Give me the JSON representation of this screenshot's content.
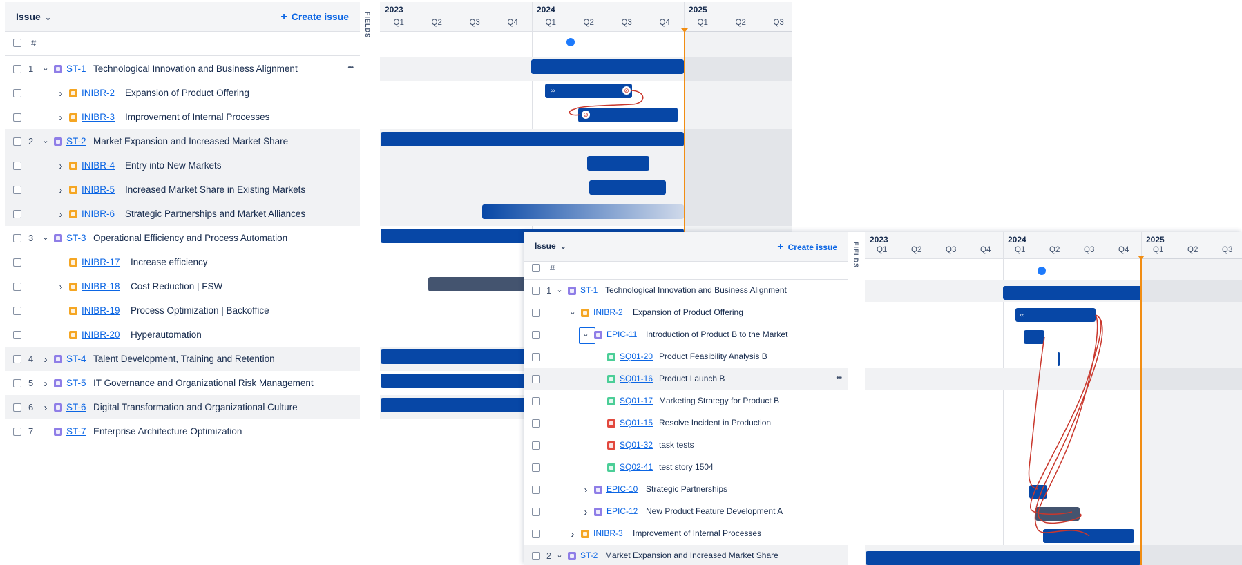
{
  "panel_a": {
    "header": {
      "issue_label": "Issue",
      "create_label": "Create issue"
    },
    "hash_label": "#",
    "fields_label": "FIELDS",
    "timeline": {
      "years": [
        "2023",
        "2024",
        "2025"
      ],
      "quarters": [
        "Q1",
        "Q2",
        "Q3",
        "Q4",
        "Q1",
        "Q2",
        "Q3",
        "Q4",
        "Q1",
        "Q2",
        "Q3"
      ]
    },
    "rows": [
      {
        "num": "1",
        "key": "ST-1",
        "title": "Technological Innovation and Business Alignment",
        "type": "story",
        "level": 0,
        "toggle": "▾"
      },
      {
        "num": "",
        "key": "INIBR-2",
        "title": "Expansion of Product Offering",
        "type": "init",
        "level": 1,
        "toggle": "›"
      },
      {
        "num": "",
        "key": "INIBR-3",
        "title": "Improvement of Internal Processes",
        "type": "init",
        "level": 1,
        "toggle": "›"
      },
      {
        "num": "2",
        "key": "ST-2",
        "title": "Market Expansion and Increased Market Share",
        "type": "story",
        "level": 0,
        "toggle": "▾"
      },
      {
        "num": "",
        "key": "INIBR-4",
        "title": "Entry into New Markets",
        "type": "init",
        "level": 1,
        "toggle": "›"
      },
      {
        "num": "",
        "key": "INIBR-5",
        "title": "Increased Market Share in Existing Markets",
        "type": "init",
        "level": 1,
        "toggle": "›"
      },
      {
        "num": "",
        "key": "INIBR-6",
        "title": "Strategic Partnerships and Market Alliances",
        "type": "init",
        "level": 1,
        "toggle": "›"
      },
      {
        "num": "3",
        "key": "ST-3",
        "title": "Operational Efficiency and Process Automation",
        "type": "story",
        "level": 0,
        "toggle": "▾"
      },
      {
        "num": "",
        "key": "INIBR-17",
        "title": "Increase efficiency",
        "type": "init",
        "level": 1,
        "toggle": ""
      },
      {
        "num": "",
        "key": "INIBR-18",
        "title": "Cost Reduction | FSW",
        "type": "init",
        "level": 1,
        "toggle": "›"
      },
      {
        "num": "",
        "key": "INIBR-19",
        "title": "Process Optimization | Backoffice",
        "type": "init",
        "level": 1,
        "toggle": ""
      },
      {
        "num": "",
        "key": "INIBR-20",
        "title": "Hyperautomation",
        "type": "init",
        "level": 1,
        "toggle": ""
      },
      {
        "num": "4",
        "key": "ST-4",
        "title": "Talent Development, Training and Retention",
        "type": "story",
        "level": 0,
        "toggle": "›"
      },
      {
        "num": "5",
        "key": "ST-5",
        "title": "IT Governance and Organizational Risk Management",
        "type": "story",
        "level": 0,
        "toggle": "›"
      },
      {
        "num": "6",
        "key": "ST-6",
        "title": "Digital Transformation and Organizational Culture",
        "type": "story",
        "level": 0,
        "toggle": "›"
      },
      {
        "num": "7",
        "key": "ST-7",
        "title": "Enterprise Architecture Optimization",
        "type": "story",
        "level": 0,
        "toggle": ""
      }
    ]
  },
  "panel_b": {
    "header": {
      "issue_label": "Issue",
      "create_label": "Create issue"
    },
    "hash_label": "#",
    "fields_label": "FIELDS",
    "timeline": {
      "years": [
        "2023",
        "2024",
        "2025"
      ],
      "quarters": [
        "Q1",
        "Q2",
        "Q3",
        "Q4",
        "Q1",
        "Q2",
        "Q3",
        "Q4",
        "Q1",
        "Q2",
        "Q3"
      ]
    },
    "rows": [
      {
        "num": "1",
        "key": "ST-1",
        "title": "Technological Innovation and Business Alignment",
        "type": "story",
        "level": 0,
        "toggle": "▾"
      },
      {
        "num": "",
        "key": "INIBR-2",
        "title": "Expansion of Product Offering",
        "type": "init",
        "level": 1,
        "toggle": "▾"
      },
      {
        "num": "",
        "key": "EPIC-11",
        "title": "Introduction of Product B to the Market",
        "type": "epic",
        "level": 2,
        "toggle": "▾"
      },
      {
        "num": "",
        "key": "SQ01-20",
        "title": "Product Feasibility Analysis B",
        "type": "sq",
        "level": 3,
        "toggle": ""
      },
      {
        "num": "",
        "key": "SQ01-16",
        "title": "Product Launch B",
        "type": "sq",
        "level": 3,
        "toggle": ""
      },
      {
        "num": "",
        "key": "SQ01-17",
        "title": "Marketing Strategy for Product B",
        "type": "sq",
        "level": 3,
        "toggle": ""
      },
      {
        "num": "",
        "key": "SQ01-15",
        "title": "Resolve Incident in Production",
        "type": "bug",
        "level": 3,
        "toggle": ""
      },
      {
        "num": "",
        "key": "SQ01-32",
        "title": "task tests",
        "type": "bug",
        "level": 3,
        "toggle": ""
      },
      {
        "num": "",
        "key": "SQ02-41",
        "title": "test story 1504",
        "type": "sq",
        "level": 3,
        "toggle": ""
      },
      {
        "num": "",
        "key": "EPIC-10",
        "title": "Strategic Partnerships",
        "type": "epic",
        "level": 2,
        "toggle": "›"
      },
      {
        "num": "",
        "key": "EPIC-12",
        "title": "New Product Feature Development A",
        "type": "epic",
        "level": 2,
        "toggle": "›"
      },
      {
        "num": "",
        "key": "INIBR-3",
        "title": "Improvement of Internal Processes",
        "type": "init",
        "level": 1,
        "toggle": "›"
      },
      {
        "num": "2",
        "key": "ST-2",
        "title": "Market Expansion and Increased Market Share",
        "type": "story",
        "level": 0,
        "toggle": "▾"
      }
    ]
  }
}
